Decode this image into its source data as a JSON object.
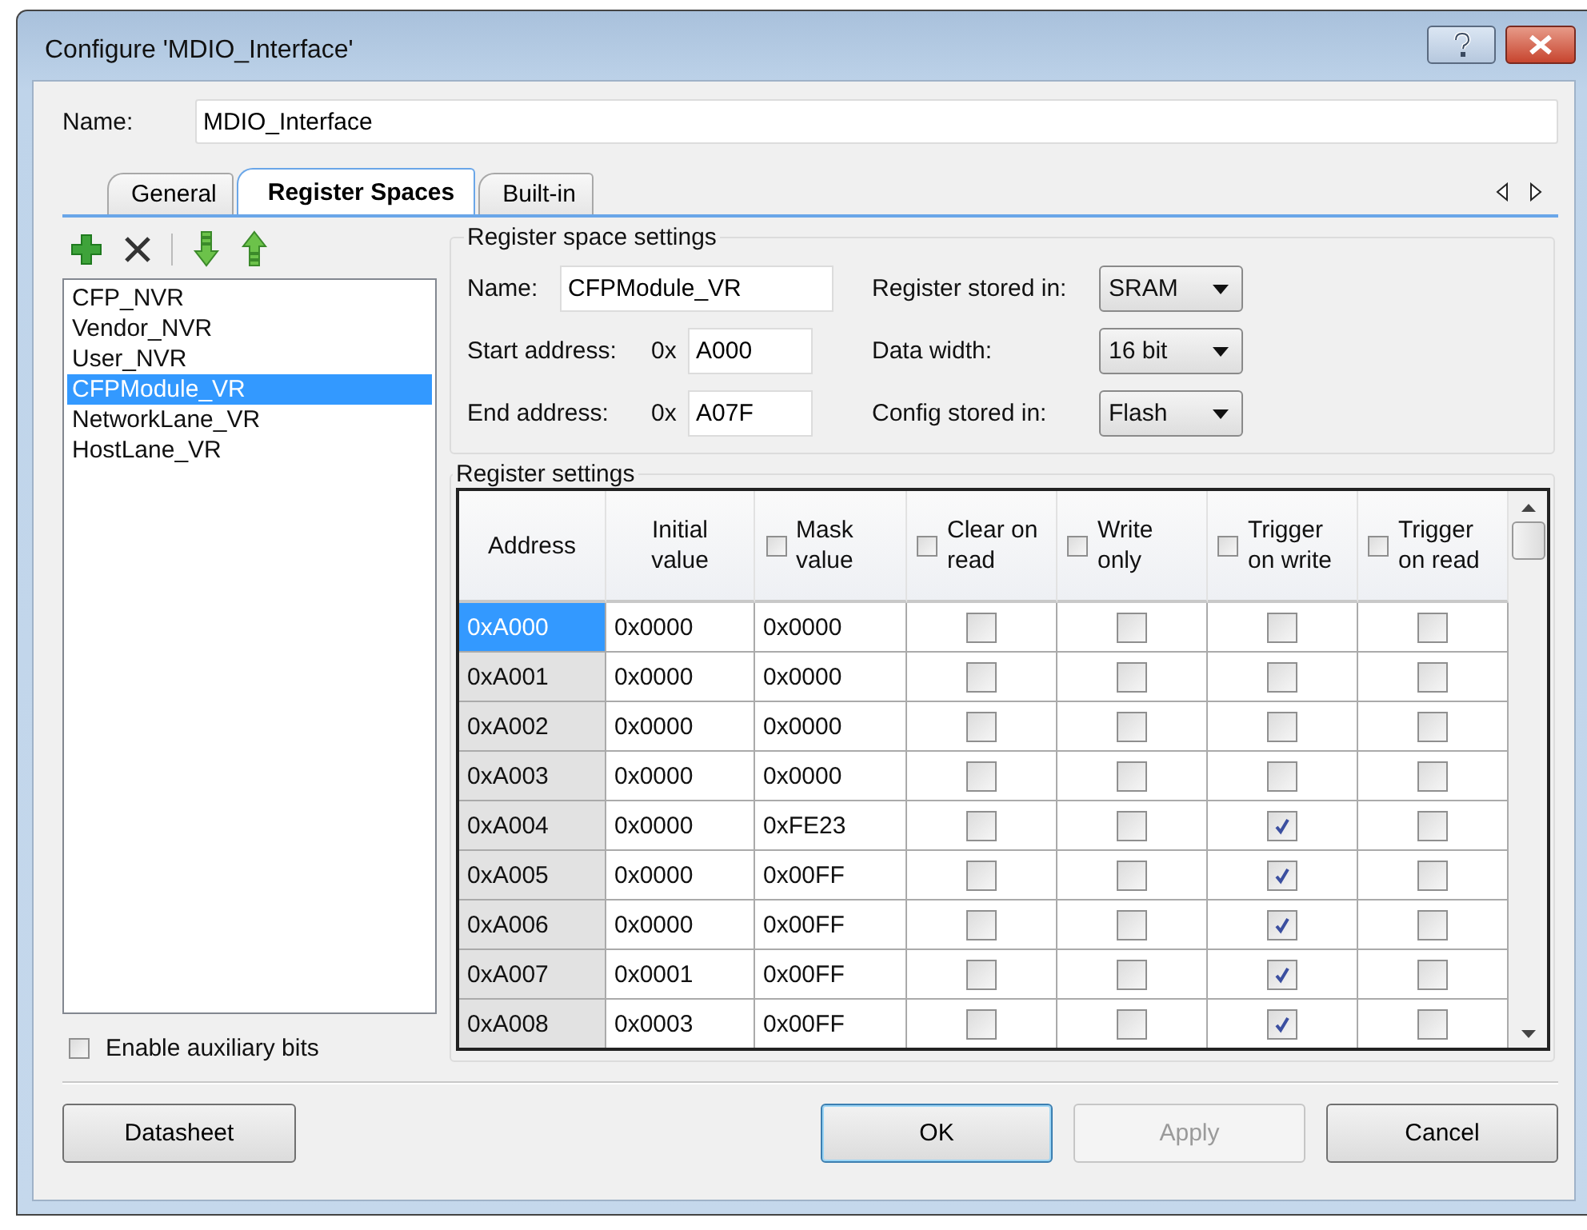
{
  "window": {
    "title": "Configure 'MDIO_Interface'"
  },
  "name_field": {
    "label": "Name:",
    "value": "MDIO_Interface"
  },
  "tabs": [
    {
      "label": "General",
      "selected": false
    },
    {
      "label": "Register Spaces",
      "selected": true
    },
    {
      "label": "Built-in",
      "selected": false
    }
  ],
  "register_spaces": [
    {
      "label": "CFP_NVR",
      "selected": false
    },
    {
      "label": "Vendor_NVR",
      "selected": false
    },
    {
      "label": "User_NVR",
      "selected": false
    },
    {
      "label": "CFPModule_VR",
      "selected": true
    },
    {
      "label": "NetworkLane_VR",
      "selected": false
    },
    {
      "label": "HostLane_VR",
      "selected": false
    }
  ],
  "enable_auxiliary_bits": {
    "label": "Enable auxiliary bits",
    "checked": false
  },
  "register_space_settings": {
    "title": "Register space settings",
    "fields": [
      {
        "label": "Name:",
        "value": "CFPModule_VR"
      },
      {
        "label": "Start address:",
        "prefix": "0x",
        "value": "A000"
      },
      {
        "label": "End address:",
        "prefix": "0x",
        "value": "A07F"
      }
    ],
    "dropdowns": [
      {
        "label": "Register stored in:",
        "value": "SRAM"
      },
      {
        "label": "Data width:",
        "value": "16 bit"
      },
      {
        "label": "Config stored in:",
        "value": "Flash"
      }
    ]
  },
  "register_settings": {
    "title": "Register settings",
    "columns": [
      {
        "label": "Address",
        "kind": "text"
      },
      {
        "label": "Initial value",
        "kind": "text"
      },
      {
        "label": "Mask value",
        "kind": "checkbox",
        "checked": false
      },
      {
        "label": "Clear on read",
        "kind": "checkbox",
        "checked": false
      },
      {
        "label": "Write only",
        "kind": "checkbox",
        "checked": false
      },
      {
        "label": "Trigger on write",
        "kind": "checkbox",
        "checked": false
      },
      {
        "label": "Trigger on read",
        "kind": "checkbox",
        "checked": false
      }
    ],
    "rows": [
      {
        "address": "0xA000",
        "initial_value": "0x0000",
        "mask_value": "0x0000",
        "flags": [
          false,
          false,
          false,
          false
        ],
        "selected": true
      },
      {
        "address": "0xA001",
        "initial_value": "0x0000",
        "mask_value": "0x0000",
        "flags": [
          false,
          false,
          false,
          false
        ],
        "selected": false
      },
      {
        "address": "0xA002",
        "initial_value": "0x0000",
        "mask_value": "0x0000",
        "flags": [
          false,
          false,
          false,
          false
        ],
        "selected": false
      },
      {
        "address": "0xA003",
        "initial_value": "0x0000",
        "mask_value": "0x0000",
        "flags": [
          false,
          false,
          false,
          false
        ],
        "selected": false
      },
      {
        "address": "0xA004",
        "initial_value": "0x0000",
        "mask_value": "0xFE23",
        "flags": [
          false,
          false,
          true,
          false
        ],
        "selected": false
      },
      {
        "address": "0xA005",
        "initial_value": "0x0000",
        "mask_value": "0x00FF",
        "flags": [
          false,
          false,
          true,
          false
        ],
        "selected": false
      },
      {
        "address": "0xA006",
        "initial_value": "0x0000",
        "mask_value": "0x00FF",
        "flags": [
          false,
          false,
          true,
          false
        ],
        "selected": false
      },
      {
        "address": "0xA007",
        "initial_value": "0x0001",
        "mask_value": "0x00FF",
        "flags": [
          false,
          false,
          true,
          false
        ],
        "selected": false
      },
      {
        "address": "0xA008",
        "initial_value": "0x0003",
        "mask_value": "0x00FF",
        "flags": [
          false,
          false,
          true,
          false
        ],
        "selected": false
      }
    ]
  },
  "buttons": [
    {
      "label": "Datasheet",
      "kind": "normal",
      "disabled": false
    },
    {
      "label": "OK",
      "kind": "default",
      "disabled": false
    },
    {
      "label": "Apply",
      "kind": "normal",
      "disabled": true
    },
    {
      "label": "Cancel",
      "kind": "normal",
      "disabled": false
    }
  ]
}
